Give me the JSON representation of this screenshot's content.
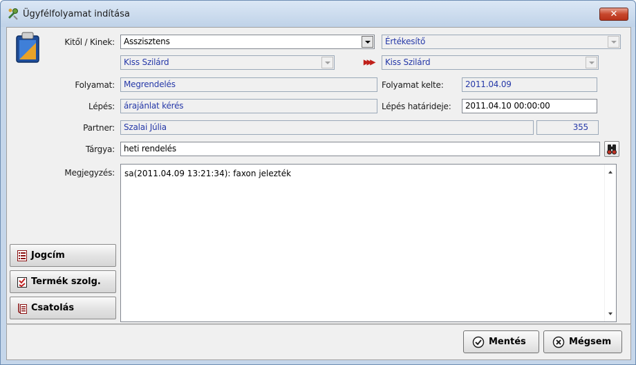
{
  "window": {
    "title": "Ügyfélfolyamat indítása",
    "close_label": "✕"
  },
  "form": {
    "kitol_label": "Kitől / Kinek:",
    "from_role": "Asszisztens",
    "to_role": "Értékesítő",
    "from_person": "Kiss Szilárd",
    "to_person": "Kiss Szilárd",
    "folyamat_label": "Folyamat:",
    "folyamat_value": "Megrendelés",
    "folyamat_kelte_label": "Folyamat kelte:",
    "folyamat_kelte_value": "2011.04.09",
    "lepes_label": "Lépés:",
    "lepes_value": "árajánlat kérés",
    "lepes_hatarideje_label": "Lépés határideje:",
    "lepes_hatarideje_value": "2011.04.10 00:00:00",
    "partner_label": "Partner:",
    "partner_value": "Szalai Júlia",
    "partner_id": "355",
    "targya_label": "Tárgya:",
    "targya_value": "heti rendelés",
    "megjegyzes_label": "Megjegyzés:",
    "megjegyzes_value": "sa(2011.04.09 13:21:34): faxon jelezték"
  },
  "side_buttons": {
    "jogcim": "Jogcím",
    "termek": "Termék szolg.",
    "csatolas": "Csatolás"
  },
  "actions": {
    "save": "Mentés",
    "cancel": "Mégsem"
  },
  "colors": {
    "accent_text": "#2538a8",
    "window_frame": "#c5d6ea"
  }
}
